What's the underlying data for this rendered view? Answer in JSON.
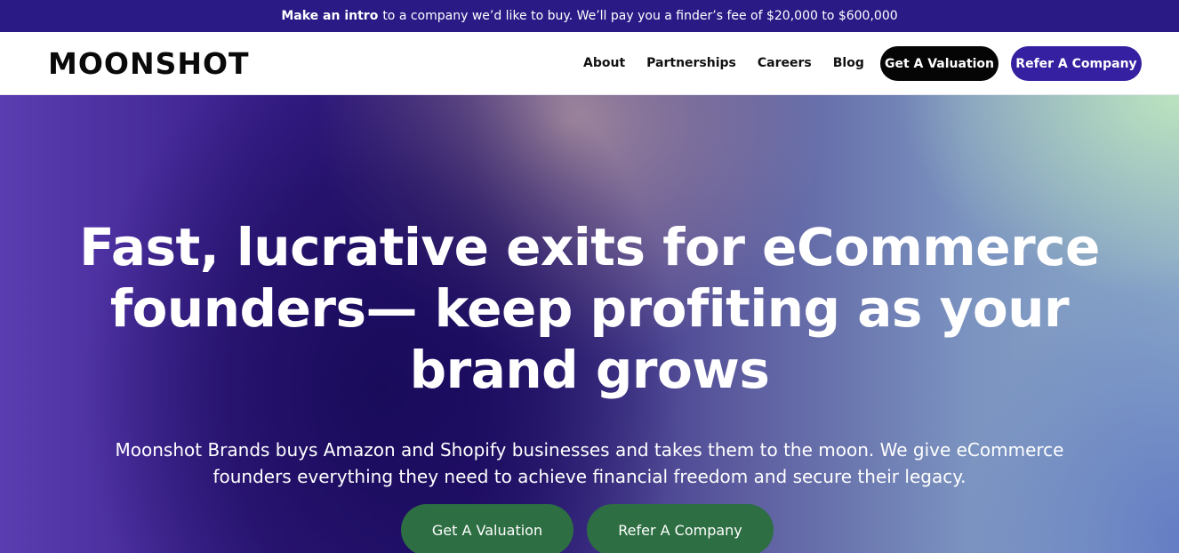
{
  "announcement": {
    "strong": "Make an intro",
    "rest": "to a company we’d like to buy. We’ll pay you a finder’s fee of $20,000 to $600,000"
  },
  "header": {
    "logo": "MOONSHOT",
    "nav": [
      "About",
      "Partnerships",
      "Careers",
      "Blog"
    ],
    "valuation_button": "Get A Valuation",
    "refer_button": "Refer A Company"
  },
  "hero": {
    "title_lines": [
      "Fast, lucrative exits for eCommerce",
      "founders— keep profiting as your",
      "brand grows"
    ],
    "subtitle_lines": [
      "Moonshot Brands buys Amazon and Shopify businesses and takes them to the moon. We give eCommerce",
      "founders everything they need to achieve financial freedom and secure their legacy."
    ],
    "cta_valuation": "Get A Valuation",
    "cta_refer": "Refer A Company"
  },
  "colors": {
    "announcement_bg": "#2a1a86",
    "refer_pill": "#3420a0",
    "cta_green": "#2d6e42"
  }
}
